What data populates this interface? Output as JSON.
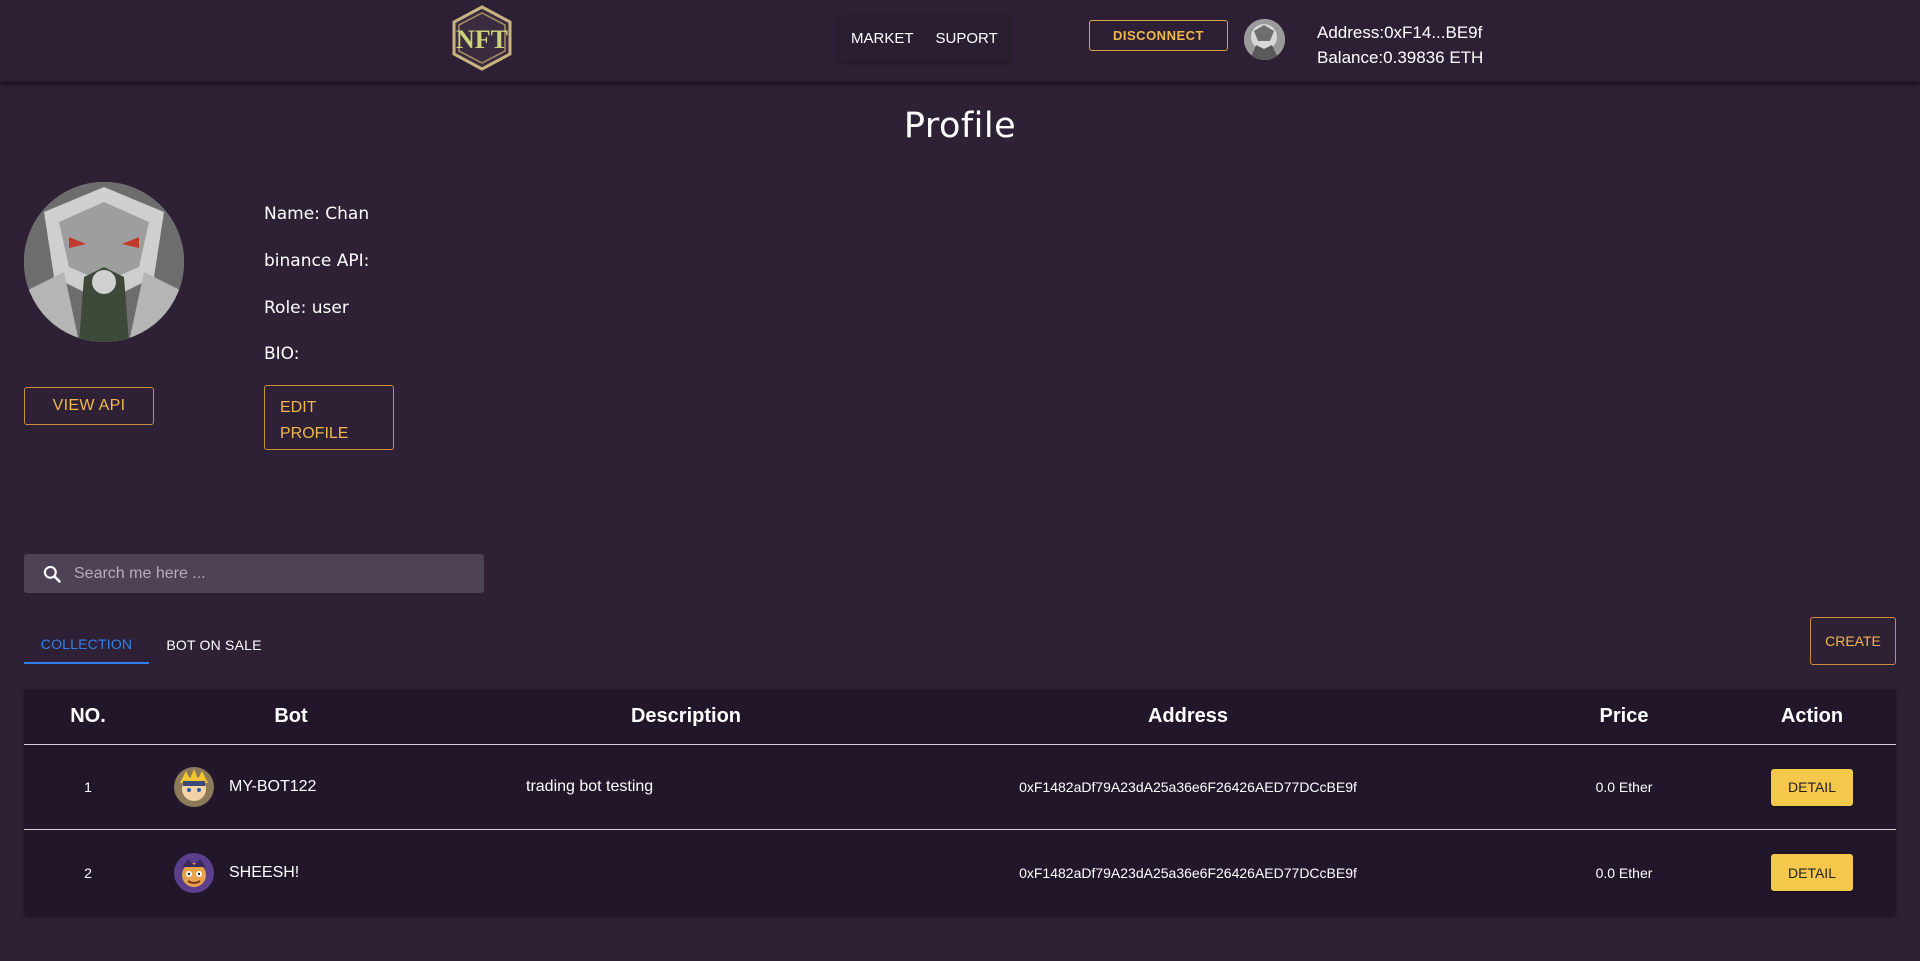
{
  "header": {
    "logo_text": "NFT",
    "nav": [
      "MARKET",
      "SUPORT"
    ],
    "disconnect_label": "DISCONNECT",
    "address_line": "Address:0xF14...BE9f",
    "balance_line": "Balance:0.39836 ETH"
  },
  "page_title": "Profile",
  "profile": {
    "name_line": "Name: Chan",
    "api_line": "binance API:",
    "role_line": "Role: user",
    "bio_line": "BIO:",
    "view_api_label": "VIEW API",
    "edit_label_1": "EDIT",
    "edit_label_2": "PROFILE"
  },
  "search": {
    "placeholder": "Search me here ..."
  },
  "tabs": [
    "COLLECTION",
    "BOT ON SALE"
  ],
  "create_label": "CREATE",
  "table": {
    "headers": [
      "NO.",
      "Bot",
      "Description",
      "Address",
      "Price",
      "Action"
    ],
    "rows": [
      {
        "no": "1",
        "bot": "MY-BOT122",
        "description": "trading bot testing",
        "address": "0xF1482aDf79A23dA25a36e6F26426AED77DCcBE9f",
        "price": "0.0 Ether",
        "action": "DETAIL"
      },
      {
        "no": "2",
        "bot": "SHEESH!",
        "description": "",
        "address": "0xF1482aDf79A23dA25a36e6F26426AED77DCcBE9f",
        "price": "0.0 Ether",
        "action": "DETAIL"
      }
    ]
  },
  "colors": {
    "background": "#2e2135",
    "accent": "#f2b84b",
    "tab_active": "#2f80ed",
    "detail_button": "#f4c84a"
  }
}
